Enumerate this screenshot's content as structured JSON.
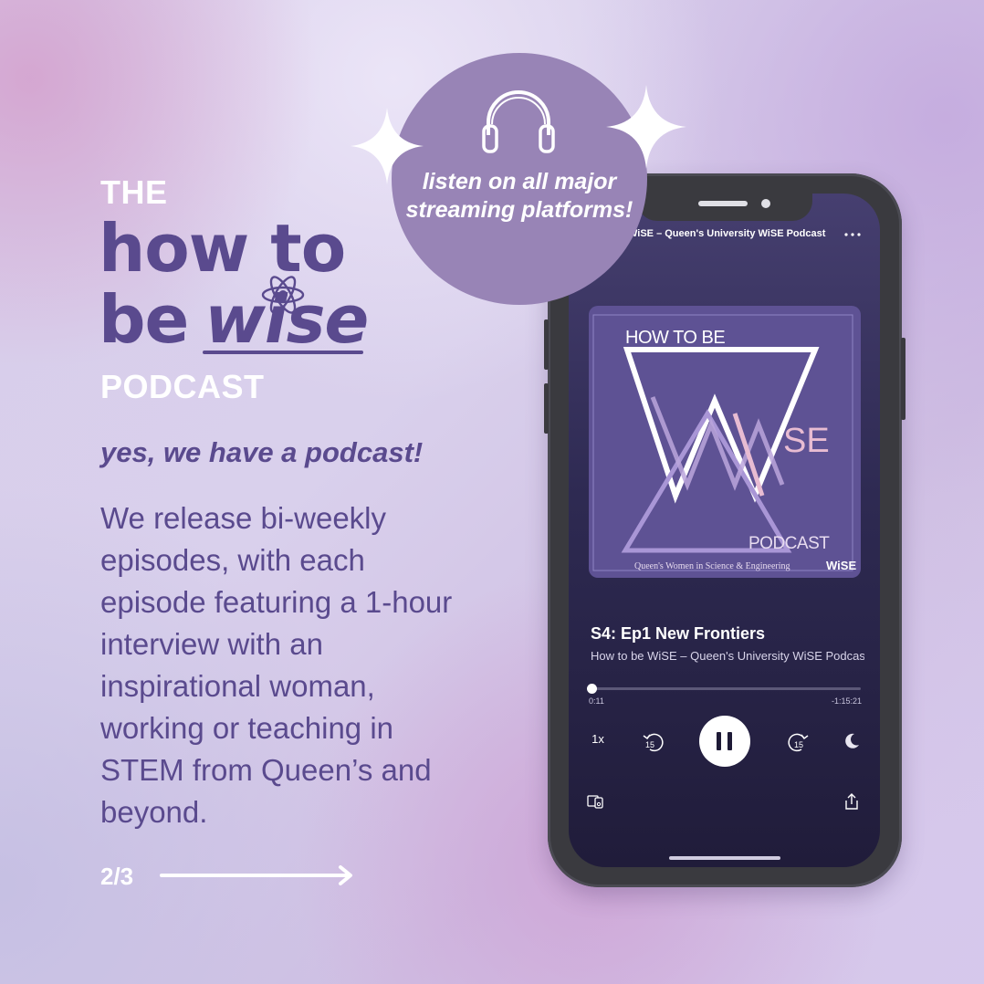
{
  "branding": {
    "title_prefix": "THE",
    "title_line1": "how to",
    "title_line2_a": "be",
    "title_line2_b": "wise",
    "title_suffix": "PODCAST"
  },
  "tagline": "yes, we have a podcast!",
  "body_text": "We release bi-weekly episodes, with each episode featuring a 1-hour interview with an inspirational woman, working or teaching in STEM from Queen’s and beyond.",
  "page_counter": "2/3",
  "badge": {
    "text": "listen on all major streaming platforms!"
  },
  "player": {
    "header_title": "WiSE – Queen's University WiSE Podcast",
    "cover": {
      "line_top": "HOW TO BE",
      "letters": "SE",
      "line_bottom": "PODCAST",
      "footer": "Queen's Women in Science & Engineering",
      "logo": "WiSE"
    },
    "episode_title": "S4: Ep1 New Frontiers",
    "show_name": "How to be WiSE – Queen's University WiSE Podcast",
    "time_elapsed": "0:11",
    "time_remaining": "-1:15:21",
    "progress_fraction": 0.0024,
    "speed": "1x",
    "skip_back_seconds": "15",
    "skip_forward_seconds": "15"
  },
  "colors": {
    "primary_purple": "#5a4a8e",
    "badge_purple": "#9884b6",
    "cover_purple": "#5e5294",
    "white": "#ffffff"
  }
}
